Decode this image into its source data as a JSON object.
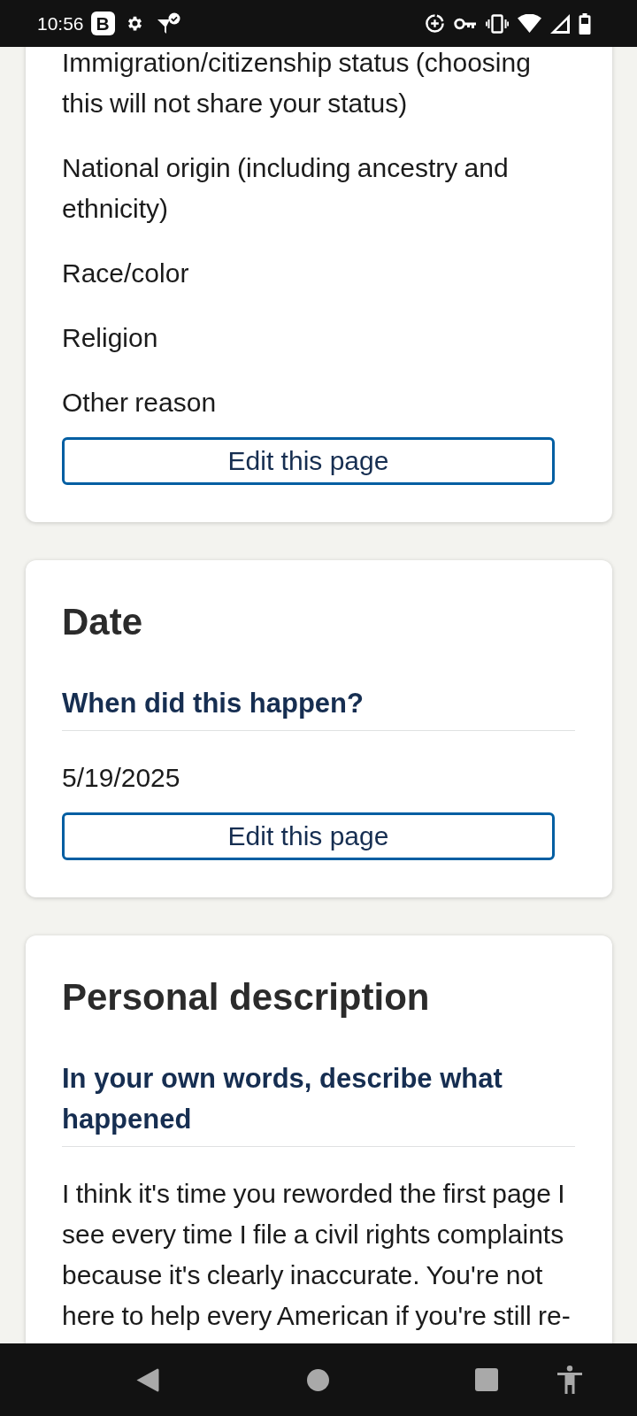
{
  "status_bar": {
    "time": "10:56",
    "app_badge": "B"
  },
  "cards": [
    {
      "answers": [
        "Immigration/citizenship status (choosing this will not share your status)",
        "National origin (including ancestry and ethnicity)",
        "Race/color",
        "Religion",
        "Other reason"
      ],
      "button": "Edit this page"
    },
    {
      "heading": "Date",
      "question": "When did this happen?",
      "answers": [
        "5/19/2025"
      ],
      "button": "Edit this page"
    },
    {
      "heading": "Personal description",
      "question": "In your own words, describe what happened",
      "answers": [
        "I think it's time you reworded the first page I see every time I file a civil rights complaints because it's clearly inaccurate. You're not here to help every American if you're still re-"
      ]
    }
  ]
}
